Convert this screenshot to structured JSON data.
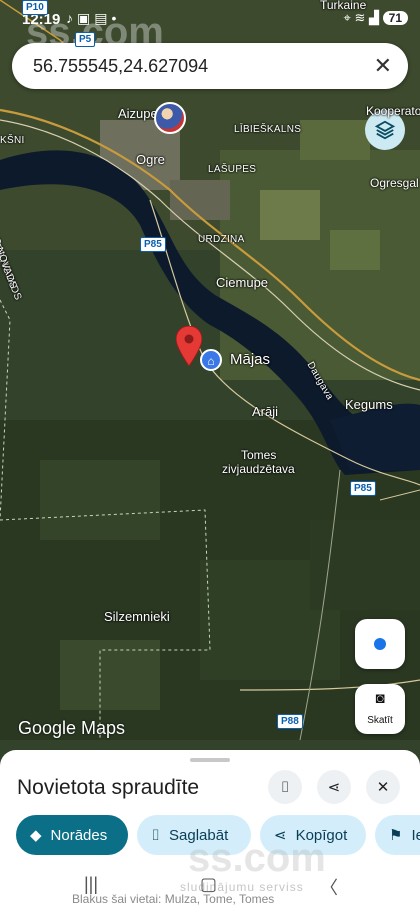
{
  "status_bar": {
    "time": "12:19",
    "left_icons": [
      "tiktok-icon",
      "screen-icon",
      "gallery-icon"
    ],
    "battery": "71"
  },
  "search": {
    "value": "56.755545,24.627094"
  },
  "map": {
    "labels": {
      "turkaine": "Turkaine",
      "aizupe": "Aizupe",
      "kooperato": "Kooperato",
      "libieskalns": "LĪBIEŠKALNS",
      "ksni": "KŠNI",
      "ogre": "Ogre",
      "lasupes": "LAŠUPES",
      "ogresgal": "Ogresgal",
      "ogres_novads": "OGRES NOVADS",
      "as_novads": "AS NOVADS",
      "urdzina": "URDZIŅA",
      "ciemupe": "Ciemupe",
      "majas": "Mājas",
      "daugava": "Daugava",
      "kegums": "Kegums",
      "araji": "Arāji",
      "tomes": "Tomes",
      "zivjaudzetava": "zivjaudzētava",
      "silzemnieki": "Silzemnieki"
    },
    "shields": {
      "p10": "P10",
      "p5": "P5",
      "p85_a": "P85",
      "p85_b": "P85",
      "p88": "P88"
    },
    "google_maps": "Google Maps",
    "watermark": "ss.com"
  },
  "controls": {
    "skatit": "Skatīt"
  },
  "sheet": {
    "title": "Novietota spraudīte",
    "chips": {
      "directions": "Norādes",
      "save": "Saglabāt",
      "share": "Kopīgot",
      "partial": "Ie"
    },
    "nearby": "Blakus šai vietai: Mulza, Tome, Tomes",
    "watermark_sub": "sludinājumu serviss"
  }
}
